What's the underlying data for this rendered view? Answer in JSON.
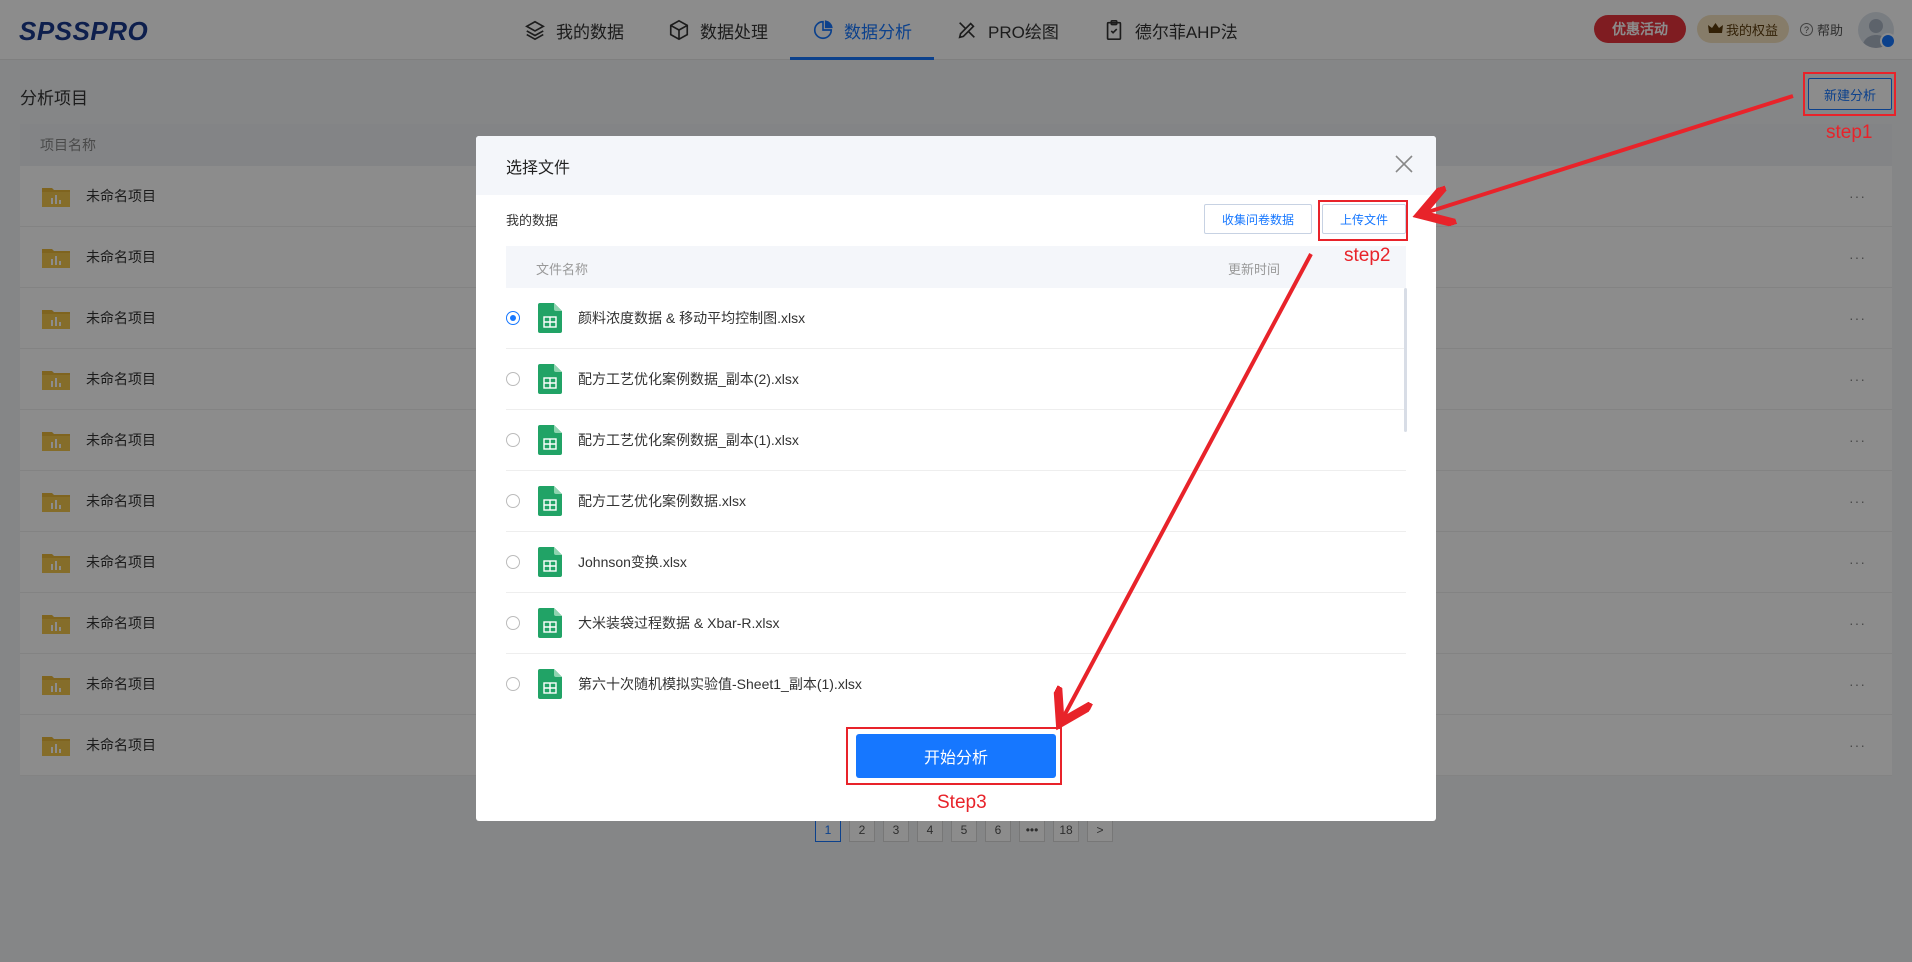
{
  "header": {
    "logo": "SPSSPRO",
    "nav": [
      {
        "label": "我的数据",
        "icon": "layers-icon"
      },
      {
        "label": "数据处理",
        "icon": "cube-icon"
      },
      {
        "label": "数据分析",
        "icon": "pie-chart-icon",
        "active": true
      },
      {
        "label": "PRO绘图",
        "icon": "drawing-tools-icon"
      },
      {
        "label": "德尔菲AHP法",
        "icon": "clipboard-check-icon"
      }
    ],
    "promo_label": "优惠活动",
    "rights_label": "我的权益",
    "help_label": "帮助"
  },
  "page": {
    "title": "分析项目",
    "new_button": "新建分析",
    "table_header": "项目名称",
    "projects": [
      "未命名项目",
      "未命名项目",
      "未命名项目",
      "未命名项目",
      "未命名项目",
      "未命名项目",
      "未命名项目",
      "未命名项目",
      "未命名项目",
      "未命名项目"
    ],
    "more_label": "···",
    "pagination": [
      "1",
      "2",
      "3",
      "4",
      "5",
      "6",
      "•••",
      "18",
      ">"
    ]
  },
  "modal": {
    "title": "选择文件",
    "section_label": "我的数据",
    "collect_button": "收集问卷数据",
    "upload_button": "上传文件",
    "col_name": "文件名称",
    "col_time": "更新时间",
    "files": [
      {
        "name": "颜料浓度数据 & 移动平均控制图.xlsx",
        "checked": true
      },
      {
        "name": "配方工艺优化案例数据_副本(2).xlsx",
        "checked": false
      },
      {
        "name": "配方工艺优化案例数据_副本(1).xlsx",
        "checked": false
      },
      {
        "name": "配方工艺优化案例数据.xlsx",
        "checked": false
      },
      {
        "name": "Johnson变换.xlsx",
        "checked": false
      },
      {
        "name": "大米装袋过程数据 & Xbar-R.xlsx",
        "checked": false
      },
      {
        "name": "第六十次随机模拟实验值-Sheet1_副本(1).xlsx",
        "checked": false
      }
    ],
    "start_button": "开始分析"
  },
  "annotations": {
    "step1": "step1",
    "step2": "step2",
    "step3": "Step3",
    "color": "#e8232a"
  },
  "colors": {
    "primary": "#1677ff",
    "promo": "#e8343d",
    "excel": "#21a366",
    "folder": "#e8b73a"
  }
}
